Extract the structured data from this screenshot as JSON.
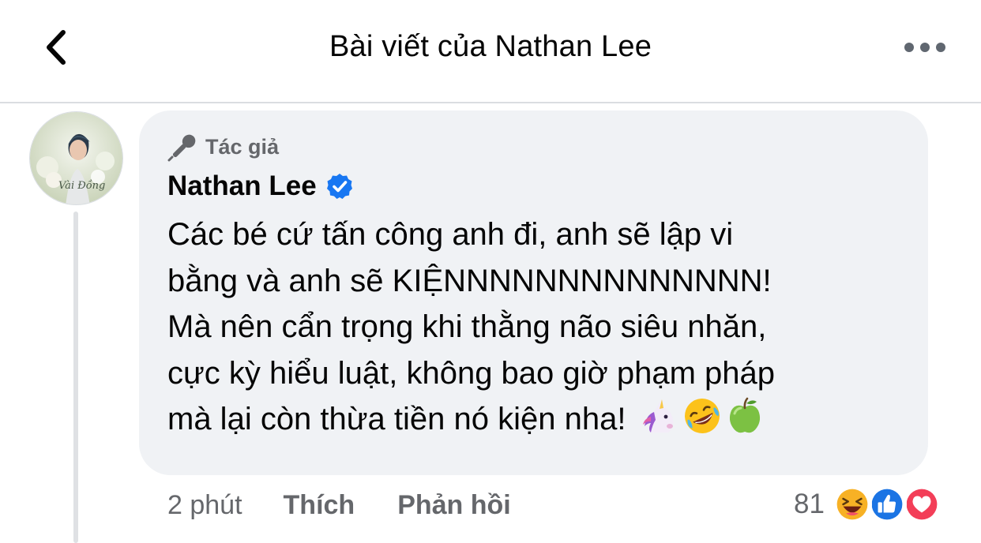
{
  "header": {
    "title": "Bài viết của Nathan Lee",
    "back_icon": "chevron-left-icon",
    "more_icon": "more-horizontal-icon"
  },
  "comment": {
    "badge": {
      "icon": "microphone-icon",
      "label": "Tác giả"
    },
    "author": "Nathan Lee",
    "verified": true,
    "avatar_caption": "Vài Đồng",
    "text": "Các bé cứ tấn công anh đi, anh sẽ lập vi\nbằng và anh sẽ KIỆNNNNNNNNNNNNNN!\nMà nên cẩn trọng khi thằng não siêu nhăn,\ncực kỳ hiểu luật, không bao giờ phạm pháp\nmà lại còn thừa tiền nó kiện nha!",
    "emojis": [
      "unicorn-icon",
      "rolling-laughing-icon",
      "green-apple-icon"
    ],
    "time": "2 phút",
    "like_label": "Thích",
    "reply_label": "Phản hồi",
    "reaction_count": "81",
    "reactions": [
      "haha-icon",
      "like-icon",
      "love-icon"
    ]
  },
  "colors": {
    "bubble": "#f0f2f5",
    "secondary_text": "#65676b",
    "verified_blue": "#1877f2",
    "love_red": "#f33e58",
    "haha_yellow": "#f7b125"
  }
}
